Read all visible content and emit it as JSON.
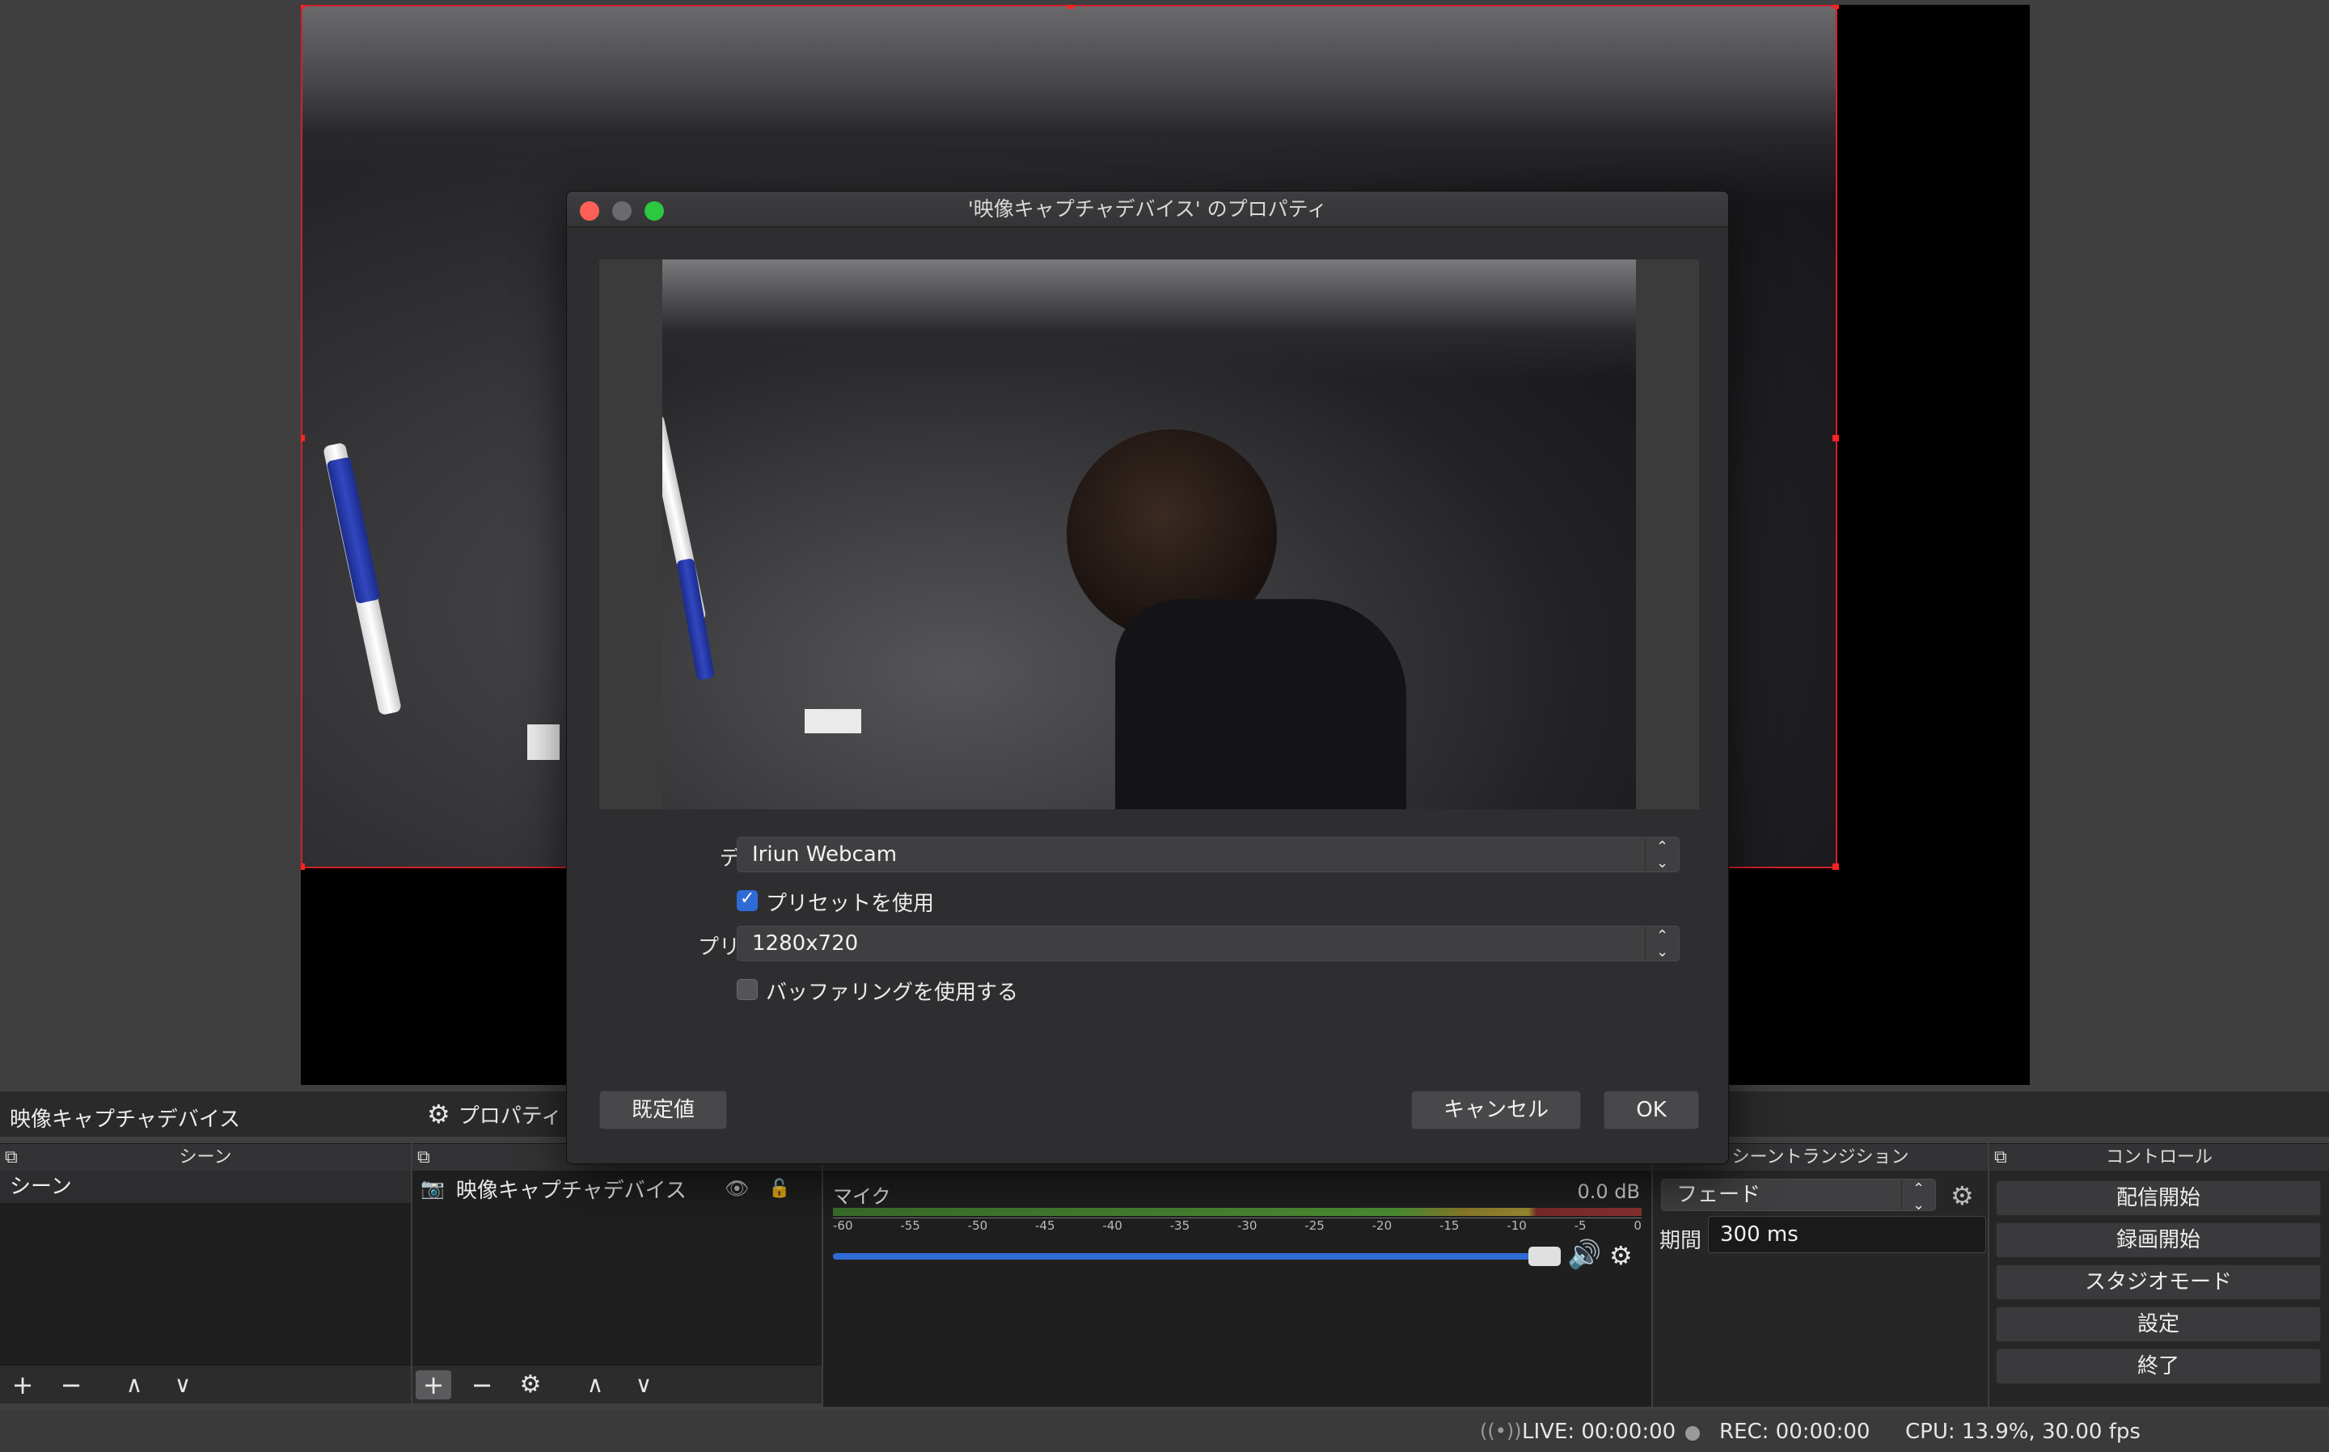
{
  "main": {
    "source_title": "映像キャプチャデバイス",
    "properties_label": "プロパティ"
  },
  "panels": {
    "scenes": {
      "header": "シーン",
      "items": [
        "シーン"
      ]
    },
    "sources": {
      "items": [
        {
          "label": "映像キャプチャデバイス"
        }
      ]
    },
    "mixer": {
      "track_name": "マイク",
      "level": "0.0 dB",
      "ticks": [
        "-60",
        "-55",
        "-50",
        "-45",
        "-40",
        "-35",
        "-30",
        "-25",
        "-20",
        "-15",
        "-10",
        "-5",
        "0"
      ]
    },
    "transitions": {
      "header": "シーントランジション",
      "selected": "フェード",
      "duration_label": "期間",
      "duration_value": "300 ms"
    },
    "controls": {
      "header": "コントロール",
      "buttons": [
        "配信開始",
        "録画開始",
        "スタジオモード",
        "設定",
        "終了"
      ]
    }
  },
  "dialog": {
    "title": "'映像キャプチャデバイス' のプロパティ",
    "device_label": "デバイス",
    "device_value": "Iriun Webcam",
    "use_preset_label": "プリセットを使用",
    "use_preset_checked": true,
    "preset_label": "プリセット",
    "preset_value": "1280x720",
    "buffering_label": "バッファリングを使用する",
    "buffering_checked": false,
    "defaults_button": "既定値",
    "cancel_button": "キャンセル",
    "ok_button": "OK"
  },
  "status": {
    "live": "LIVE: 00:00:00",
    "rec": "REC: 00:00:00",
    "cpu": "CPU: 13.9%, 30.00 fps"
  },
  "colors": {
    "selection_red": "#d2202a",
    "accent_blue": "#2f6bd6",
    "close": "#fe5f57",
    "minimize_inactive": "#6b6b6d",
    "zoom": "#2bc840"
  }
}
